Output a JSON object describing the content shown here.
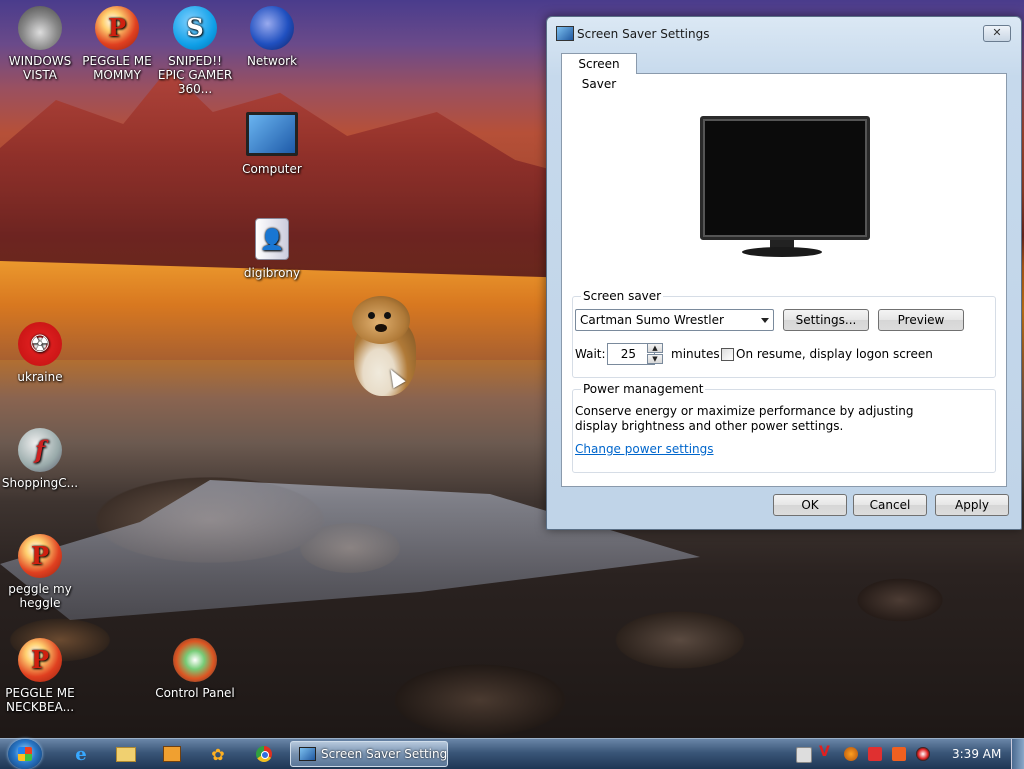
{
  "desktop": {
    "icons": [
      {
        "label": "WINDOWS VISTA"
      },
      {
        "label": "PEGGLE ME MOMMY"
      },
      {
        "label": "SNIPED!! EPIC GAMER 360..."
      },
      {
        "label": "Network"
      },
      {
        "label": "Computer"
      },
      {
        "label": "digibrony"
      },
      {
        "label": "ukraine"
      },
      {
        "label": "ShoppingC..."
      },
      {
        "label": "peggle my heggle"
      },
      {
        "label": "PEGGLE ME NECKBEA..."
      },
      {
        "label": "Control Panel"
      }
    ]
  },
  "dialog": {
    "title": "Screen Saver Settings",
    "close_label": "✕",
    "tab_label": "Screen Saver",
    "screensaver": {
      "group_label": "Screen saver",
      "selected": "Cartman Sumo Wrestler",
      "settings_label": "Settings...",
      "preview_label": "Preview",
      "wait_label": "Wait:",
      "wait_value": "25",
      "minutes_label": "minutes",
      "resume_label": "On resume, display logon screen"
    },
    "power": {
      "group_label": "Power management",
      "description": "Conserve energy or maximize performance by adjusting display brightness and other power settings.",
      "link": "Change power settings"
    },
    "ok_label": "OK",
    "cancel_label": "Cancel",
    "apply_label": "Apply"
  },
  "taskbar": {
    "active_task": "Screen Saver Settings",
    "clock": "3:39 AM"
  }
}
